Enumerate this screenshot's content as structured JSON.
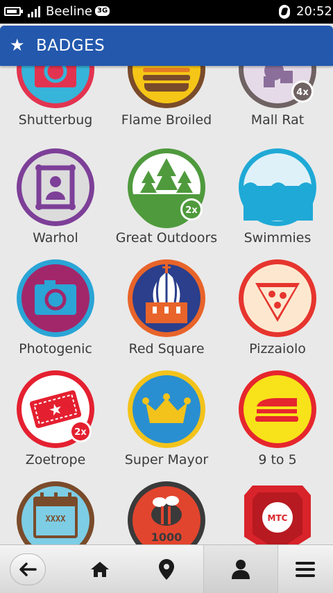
{
  "status_bar": {
    "carrier": "Beeline",
    "network": "3G",
    "time": "20:52"
  },
  "header": {
    "title": "BADGES",
    "icon": "star-icon"
  },
  "badges": [
    {
      "name": "Shutterbug"
    },
    {
      "name": "Flame Broiled"
    },
    {
      "name": "Mall Rat",
      "multiplier": "4x"
    },
    {
      "name": "Warhol"
    },
    {
      "name": "Great Outdoors",
      "multiplier": "2x"
    },
    {
      "name": "Swimmies"
    },
    {
      "name": "Photogenic"
    },
    {
      "name": "Red Square"
    },
    {
      "name": "Pizzaiolo"
    },
    {
      "name": "Zoetrope",
      "multiplier": "2x"
    },
    {
      "name": "Super Mayor"
    },
    {
      "name": "9 to 5"
    },
    {
      "name": "Calendar badge",
      "grid_text": "XXXX"
    },
    {
      "name": "1000 badge",
      "count_text": "1000"
    },
    {
      "name": "MTC badge",
      "logo_text": "MTC"
    }
  ],
  "toolbar": {
    "items": [
      "back-icon",
      "home-icon",
      "location-pin-icon",
      "profile-icon",
      "menu-icon"
    ],
    "active": "profile-icon"
  },
  "colors": {
    "header": "#2358ad",
    "background": "#e9e9e9"
  }
}
